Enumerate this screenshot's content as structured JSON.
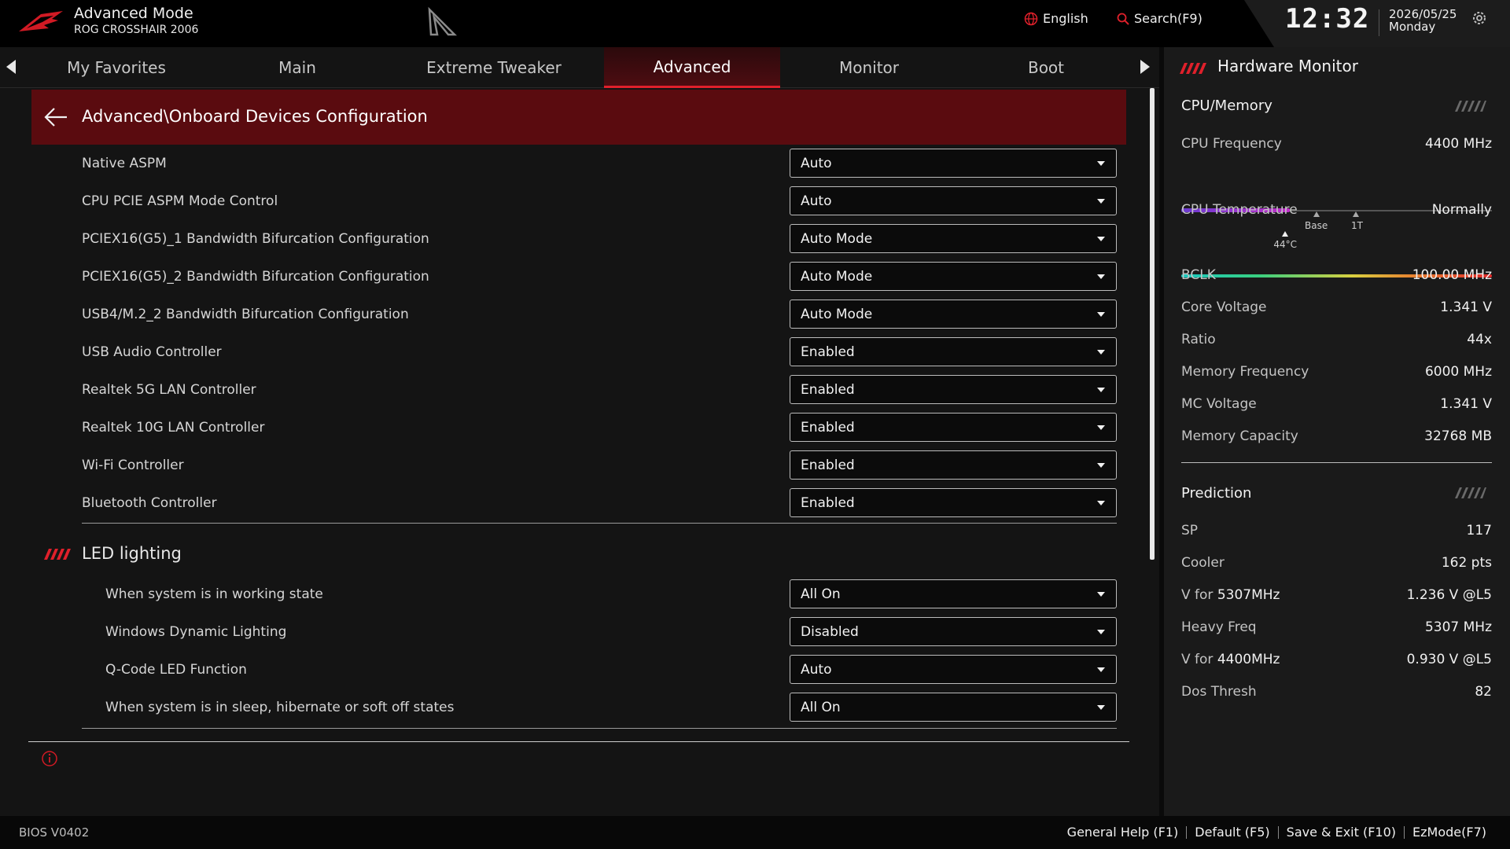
{
  "header": {
    "mode_title": "Advanced Mode",
    "board_name": "ROG CROSSHAIR 2006",
    "language": "English",
    "search": "Search(F9)",
    "time": "12:32",
    "date": "2026/05/25",
    "weekday": "Monday"
  },
  "tabs": [
    {
      "label": "My Favorites",
      "active": false
    },
    {
      "label": "Main",
      "active": false
    },
    {
      "label": "Extreme Tweaker",
      "active": false
    },
    {
      "label": "Advanced",
      "active": true
    },
    {
      "label": "Monitor",
      "active": false
    },
    {
      "label": "Boot",
      "active": false
    }
  ],
  "main": {
    "breadcrumb": "Advanced\\Onboard Devices Configuration",
    "settings": [
      {
        "label": "Native ASPM",
        "value": "Auto"
      },
      {
        "label": "CPU PCIE ASPM Mode Control",
        "value": "Auto"
      },
      {
        "label": "PCIEX16(G5)_1 Bandwidth Bifurcation Configuration",
        "value": "Auto Mode"
      },
      {
        "label": "PCIEX16(G5)_2 Bandwidth Bifurcation Configuration",
        "value": "Auto Mode"
      },
      {
        "label": "USB4/M.2_2 Bandwidth Bifurcation Configuration",
        "value": "Auto Mode"
      },
      {
        "label": "USB Audio Controller",
        "value": "Enabled"
      },
      {
        "label": "Realtek 5G LAN Controller",
        "value": "Enabled"
      },
      {
        "label": "Realtek 10G LAN Controller",
        "value": "Enabled"
      },
      {
        "label": "Wi-Fi Controller",
        "value": "Enabled"
      },
      {
        "label": "Bluetooth Controller",
        "value": "Enabled"
      }
    ],
    "led_section_title": "LED lighting",
    "led_settings": [
      {
        "label": "When system is in working state",
        "value": "All On"
      },
      {
        "label": "Windows Dynamic Lighting",
        "value": "Disabled"
      },
      {
        "label": "Q-Code LED Function",
        "value": "Auto"
      },
      {
        "label": "When system is in sleep, hibernate or soft off states",
        "value": "All On"
      }
    ]
  },
  "hardware_monitor": {
    "title": "Hardware Monitor",
    "cpu_memory_title": "CPU/Memory",
    "cpu_frequency": {
      "label": "CPU Frequency",
      "value": "4400 MHz",
      "fill_fraction": 0.35,
      "marker_base": "Base",
      "marker_1t": "1T"
    },
    "cpu_temperature": {
      "label": "CPU Temperature",
      "value": "Normally",
      "marker": "44°C",
      "fraction": 0.335
    },
    "items": [
      {
        "label": "BCLK",
        "value": "100.00 MHz"
      },
      {
        "label": "Core Voltage",
        "value": "1.341 V"
      },
      {
        "label": "Ratio",
        "value": "44x"
      },
      {
        "label": "Memory Frequency",
        "value": "6000 MHz"
      },
      {
        "label": "MC Voltage",
        "value": "1.341 V"
      },
      {
        "label": "Memory Capacity",
        "value": "32768 MB"
      }
    ],
    "prediction_title": "Prediction",
    "prediction": {
      "sp": {
        "label": "SP",
        "value": "117"
      },
      "cooler": {
        "label": "Cooler",
        "value": "162 pts"
      },
      "v_for_1": {
        "label": "V for ",
        "freq": "5307MHz",
        "value": "1.236 V @L5"
      },
      "heavy_freq": {
        "label": "Heavy Freq",
        "value": "5307 MHz"
      },
      "v_for_2": {
        "label": "V for ",
        "freq": "4400MHz",
        "value": "0.930 V @L5"
      },
      "dos_thresh": {
        "label": "Dos Thresh",
        "value": "82"
      }
    }
  },
  "footer": {
    "bios_version": "BIOS V0402",
    "keys": [
      "General Help (F1)",
      "Default (F5)",
      "Save & Exit (F10)",
      "EzMode(F7)"
    ]
  },
  "colors": {
    "accent": "#e0202b",
    "breadcrumb_bg": "#5a0b0f",
    "background": "#141414"
  }
}
